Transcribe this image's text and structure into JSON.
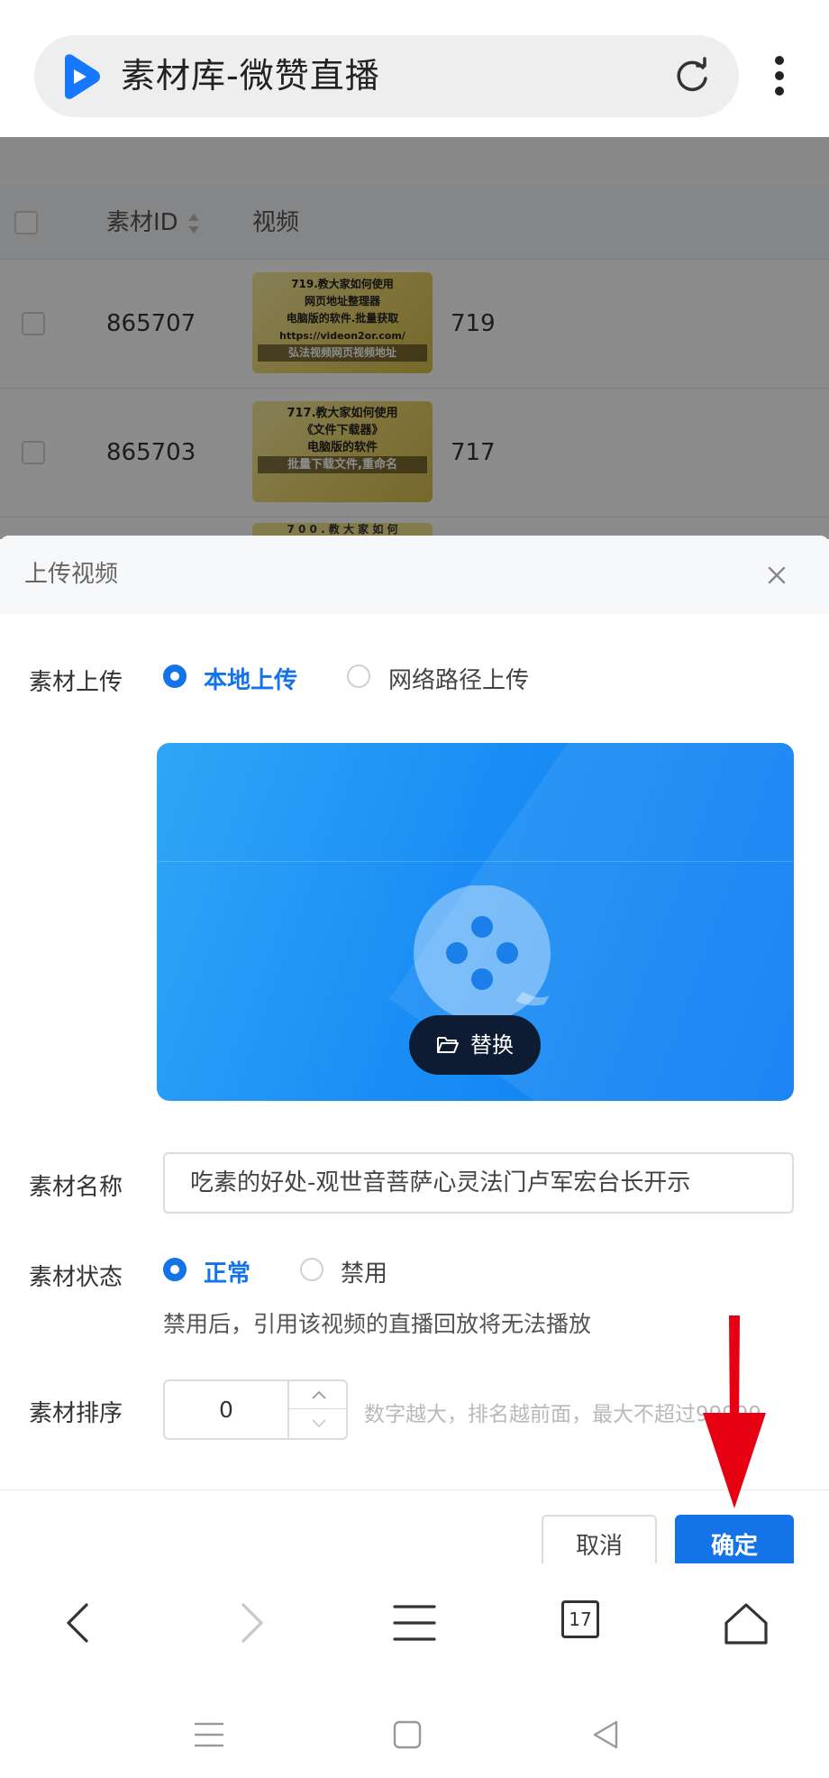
{
  "browser": {
    "tab_title": "素材库-微赞直播",
    "logo_icon": "play-logo-icon",
    "reload_icon": "reload-icon",
    "menu_icon": "more-vert-icon",
    "tab_count": "17"
  },
  "table": {
    "headers": {
      "id": "素材ID",
      "video": "视频"
    },
    "rows": [
      {
        "id": "865707",
        "name": "719",
        "thumb_lines": [
          "719.教大家如何使用",
          "网页地址整理器",
          "电脑版的软件.批量获取",
          "https://videon2or.com/",
          "弘法视频网页视频地址"
        ]
      },
      {
        "id": "865703",
        "name": "717",
        "thumb_lines": [
          "717.教大家如何使用",
          "《文件下载器》",
          "电脑版的软件",
          "批量下载文件,重命名"
        ]
      }
    ],
    "peek_text": "7 0 0 . 教 大 家 如 何"
  },
  "modal": {
    "title": "上传视频",
    "close_icon": "close-icon",
    "upload_label": "素材上传",
    "upload_options": [
      "本地上传",
      "网络路径上传"
    ],
    "upload_selected": 0,
    "replace_label": "替换",
    "name_label": "素材名称",
    "name_value": "吃素的好处-观世音菩萨心灵法门卢军宏台长开示",
    "status_label": "素材状态",
    "status_options": [
      "正常",
      "禁用"
    ],
    "status_selected": 0,
    "status_hint": "禁用后，引用该视频的直播回放将无法播放",
    "sort_label": "素材排序",
    "sort_value": "0",
    "sort_hint": "数字越大，排名越前面，最大不超过99999",
    "cancel_label": "取消",
    "ok_label": "确定"
  },
  "colors": {
    "accent": "#1473e6",
    "annotation_arrow": "#e60012"
  }
}
